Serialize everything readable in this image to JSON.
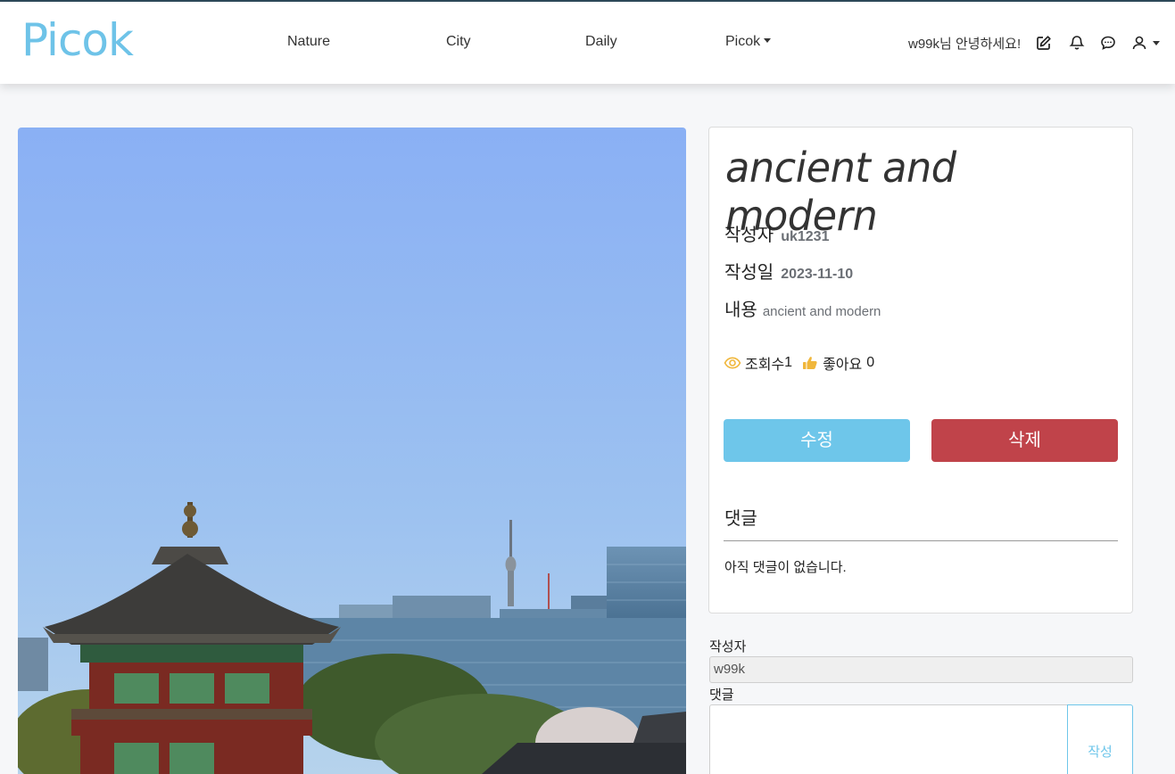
{
  "brand": "Picok",
  "nav": {
    "items": [
      "Nature",
      "City",
      "Daily",
      "Picok"
    ],
    "greeting": "w99k님 안녕하세요!",
    "icons": [
      "edit-icon",
      "bell-icon",
      "chat-icon",
      "user-icon"
    ]
  },
  "post": {
    "title": "ancient and modern",
    "author_label": "작성자",
    "author": "uk1231",
    "date_label": "작성일",
    "date": "2023-11-10",
    "content_label": "내용",
    "content": "ancient and modern",
    "views_label": "조회수",
    "views": "1",
    "likes_label": "좋아요",
    "likes": "0",
    "edit_button": "수정",
    "delete_button": "삭제",
    "comments_heading": "댓글",
    "no_comments": "아직 댓글이 없습니다."
  },
  "comment_form": {
    "author_label": "작성자",
    "author_value": "w99k",
    "comment_label": "댓글",
    "submit": "작성"
  },
  "colors": {
    "brand": "#6ec3e8",
    "edit": "#6ec6ea",
    "delete": "#c0434a",
    "icon_accent": "#f0b73c"
  }
}
